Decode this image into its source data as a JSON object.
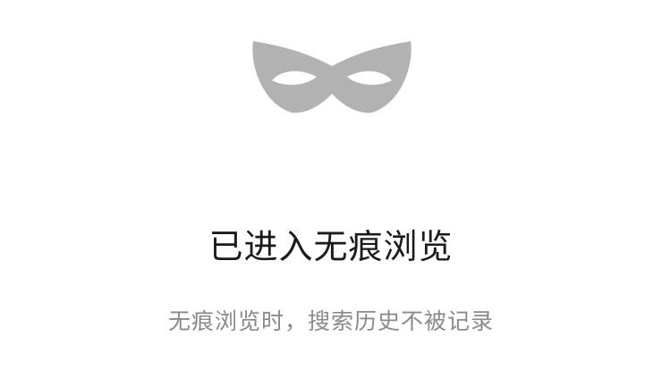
{
  "icon": {
    "name": "incognito-mask-icon",
    "color": "#b2b2b2"
  },
  "title": "已进入无痕浏览",
  "subtitle": "无痕浏览时，搜索历史不被记录",
  "colors": {
    "background": "#ffffff",
    "title": "#1b1b1b",
    "subtitle": "#8a8a8a"
  }
}
